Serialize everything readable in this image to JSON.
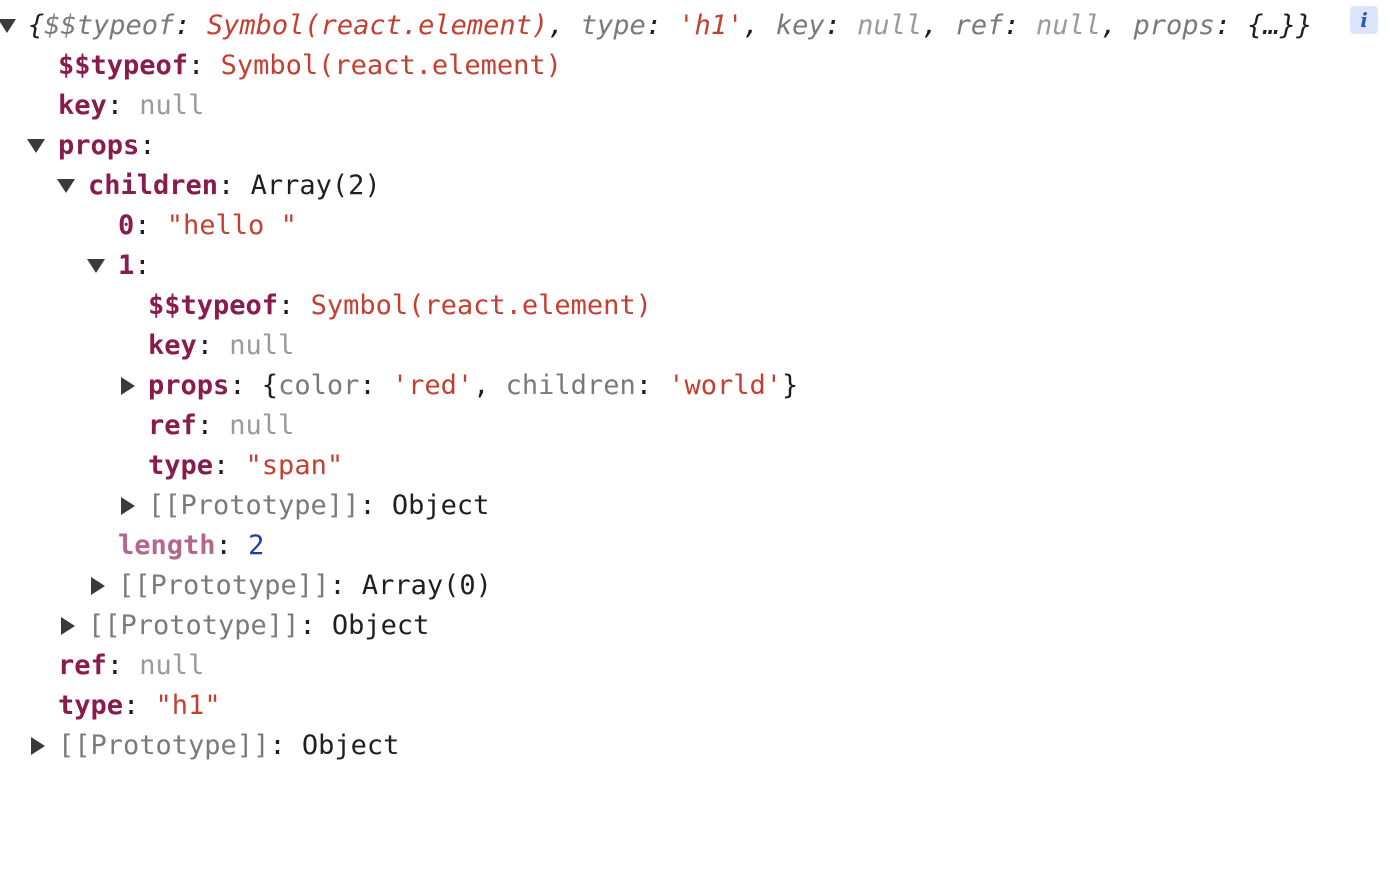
{
  "summary": {
    "open": "{",
    "k_typeof": "$$typeof",
    "v_typeof": "Symbol(react.element)",
    "k_type": "type",
    "v_type": "'h1'",
    "k_key": "key",
    "v_key": "null",
    "k_ref": "ref",
    "v_ref": "null",
    "k_props": "props",
    "v_props": "{…}",
    "close": "}",
    "info": "i"
  },
  "root": {
    "typeof_key": "$$typeof",
    "typeof_val": "Symbol(react.element)",
    "key_key": "key",
    "key_val": "null",
    "props_key": "props",
    "children_key": "children",
    "children_val": "Array(2)",
    "item0_key": "0",
    "item0_val": "\"hello \"",
    "item1_key": "1",
    "span": {
      "typeof_key": "$$typeof",
      "typeof_val": "Symbol(react.element)",
      "key_key": "key",
      "key_val": "null",
      "props_key": "props",
      "props_open": "{",
      "color_key": "color",
      "color_val": "'red'",
      "children_key": "children",
      "children_val": "'world'",
      "props_close": "}",
      "ref_key": "ref",
      "ref_val": "null",
      "type_key": "type",
      "type_val": "\"span\"",
      "proto_key": "[[Prototype]]",
      "proto_val": "Object"
    },
    "length_key": "length",
    "length_val": "2",
    "array_proto_key": "[[Prototype]]",
    "array_proto_val": "Array(0)",
    "props_proto_key": "[[Prototype]]",
    "props_proto_val": "Object",
    "ref_key": "ref",
    "ref_val": "null",
    "type_key": "type",
    "type_val": "\"h1\"",
    "proto_key": "[[Prototype]]",
    "proto_val": "Object"
  }
}
